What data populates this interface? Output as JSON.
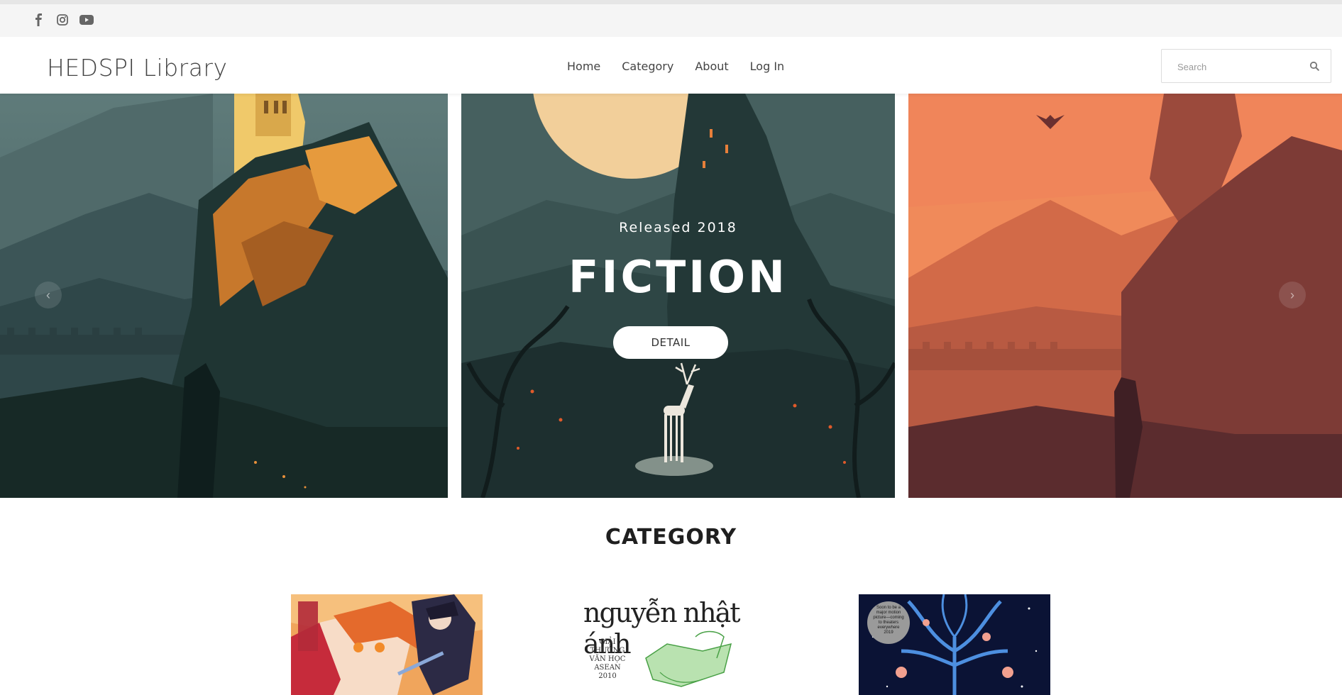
{
  "social": {
    "icons": [
      "facebook-icon",
      "instagram-icon",
      "youtube-icon"
    ]
  },
  "navbar": {
    "brand": "HEDSPI Library",
    "menu": [
      {
        "label": "Home"
      },
      {
        "label": "Category"
      },
      {
        "label": "About"
      },
      {
        "label": "Log In"
      }
    ],
    "search": {
      "placeholder": "Search",
      "value": ""
    }
  },
  "hero": {
    "active_slide": 2,
    "caption": {
      "subtitle": "Released 2018",
      "title": "FICTION",
      "button_label": "DETAIL"
    },
    "prev_label": "‹",
    "next_label": "›"
  },
  "category": {
    "title": "CATEGORY",
    "cards": [
      {
        "cover": "anime-novel-cover"
      },
      {
        "cover": "nguyen-nhat-anh-cover",
        "cover_title": "nguyễn nhật ánh",
        "cover_text": "GIẢI THƯỞNG VĂN HỌC ASEAN 2010"
      },
      {
        "cover": "blue-tree-cover",
        "cover_text": "Soon to be a major motion picture—coming to theaters everywhere 2019"
      }
    ]
  },
  "colors": {
    "topbar_bg": "#f5f5f5",
    "brand_text": "#444444",
    "heading": "#1f1f1f"
  }
}
